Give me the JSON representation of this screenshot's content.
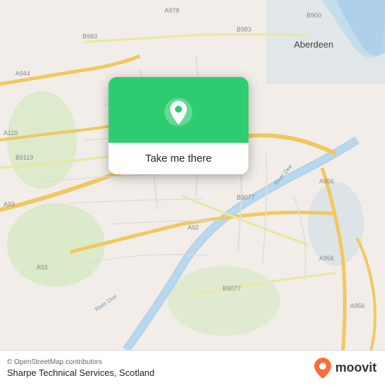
{
  "map": {
    "background_color": "#e8e0d8",
    "popup": {
      "button_label": "Take me there"
    }
  },
  "bottom_bar": {
    "copyright": "© OpenStreetMap contributors",
    "location": "Sharpe Technical Services, Scotland",
    "logo_text": "moovit"
  },
  "road_labels": [
    "A978",
    "B900",
    "A944",
    "B983",
    "B983",
    "A119",
    "B9119",
    "A93",
    "A93",
    "A92",
    "B9077",
    "B9077",
    "A956",
    "A956",
    "A956",
    "Aberdeen",
    "River Dee",
    "River Dee"
  ]
}
